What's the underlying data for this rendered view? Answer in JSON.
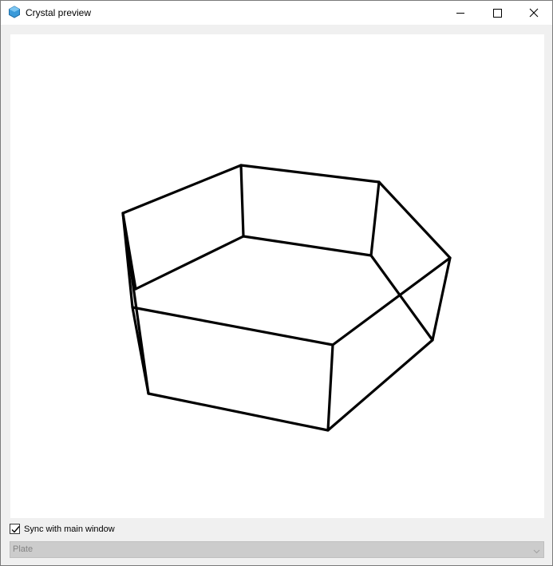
{
  "window": {
    "title": "Crystal preview",
    "icon": "crystal-hexagon-icon",
    "controls": {
      "minimize": "minimize-icon",
      "maximize": "maximize-icon",
      "close": "close-icon"
    }
  },
  "colors": {
    "icon_fill": "#3a9ad9",
    "edge_color": "#000000",
    "viewport_bg": "#ffffff"
  },
  "options": {
    "sync_label": "Sync with main window",
    "sync_checked": true,
    "shape_selected": "Plate",
    "shape_enabled": false
  }
}
